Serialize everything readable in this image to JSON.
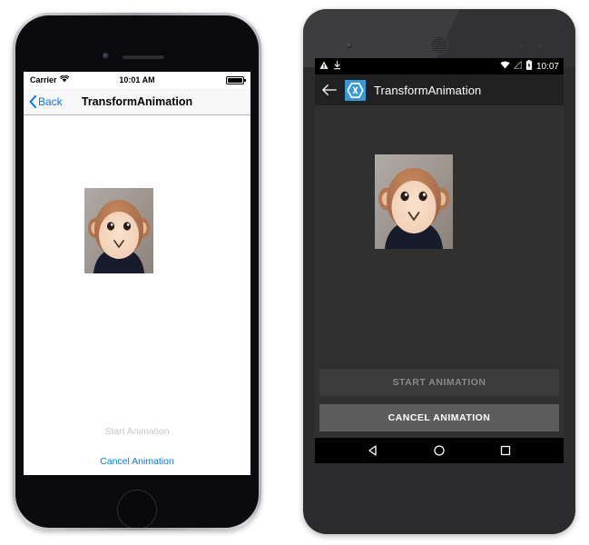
{
  "ios": {
    "status": {
      "carrier": "Carrier",
      "wifi_icon": "wifi-icon",
      "time": "10:01 AM",
      "battery_icon": "battery-full-icon"
    },
    "navbar": {
      "back_icon": "chevron-left-icon",
      "back_label": "Back",
      "title": "TransformAnimation"
    },
    "content": {
      "image_name": "monkey-photo"
    },
    "buttons": {
      "start_label": "Start Animation",
      "start_disabled": true,
      "cancel_label": "Cancel Animation",
      "cancel_disabled": false
    },
    "colors": {
      "accent": "#007aff",
      "disabled": "#c7c7cc",
      "navbar_bg": "#f8f8f8"
    },
    "hardware": {
      "camera": "front-camera",
      "speaker": "earpiece-speaker",
      "home_button": "home-button"
    }
  },
  "android": {
    "status": {
      "warning_icon": "warning-triangle-icon",
      "download_icon": "download-icon",
      "wifi_icon": "wifi-icon",
      "signal_icon": "signal-none-icon",
      "battery_icon": "battery-charging-icon",
      "time": "10:07"
    },
    "toolbar": {
      "back_icon": "arrow-back-icon",
      "logo_icon": "xamarin-logo-icon",
      "title": "TransformAnimation"
    },
    "content": {
      "image_name": "monkey-photo"
    },
    "buttons": {
      "start_label": "START ANIMATION",
      "start_disabled": true,
      "cancel_label": "CANCEL ANIMATION",
      "cancel_disabled": false
    },
    "navbar": {
      "back_icon": "nav-back-triangle-icon",
      "home_icon": "nav-home-circle-icon",
      "recents_icon": "nav-recents-square-icon"
    },
    "colors": {
      "toolbar_bg": "#212121",
      "content_bg": "#303030",
      "logo_bg": "#3498db",
      "button_enabled_bg": "#5d5d5d",
      "button_disabled_bg": "#3b3b3b"
    },
    "hardware": {
      "camera": "front-camera",
      "speaker": "earpiece-speaker",
      "sensors": "proximity-sensors"
    }
  }
}
